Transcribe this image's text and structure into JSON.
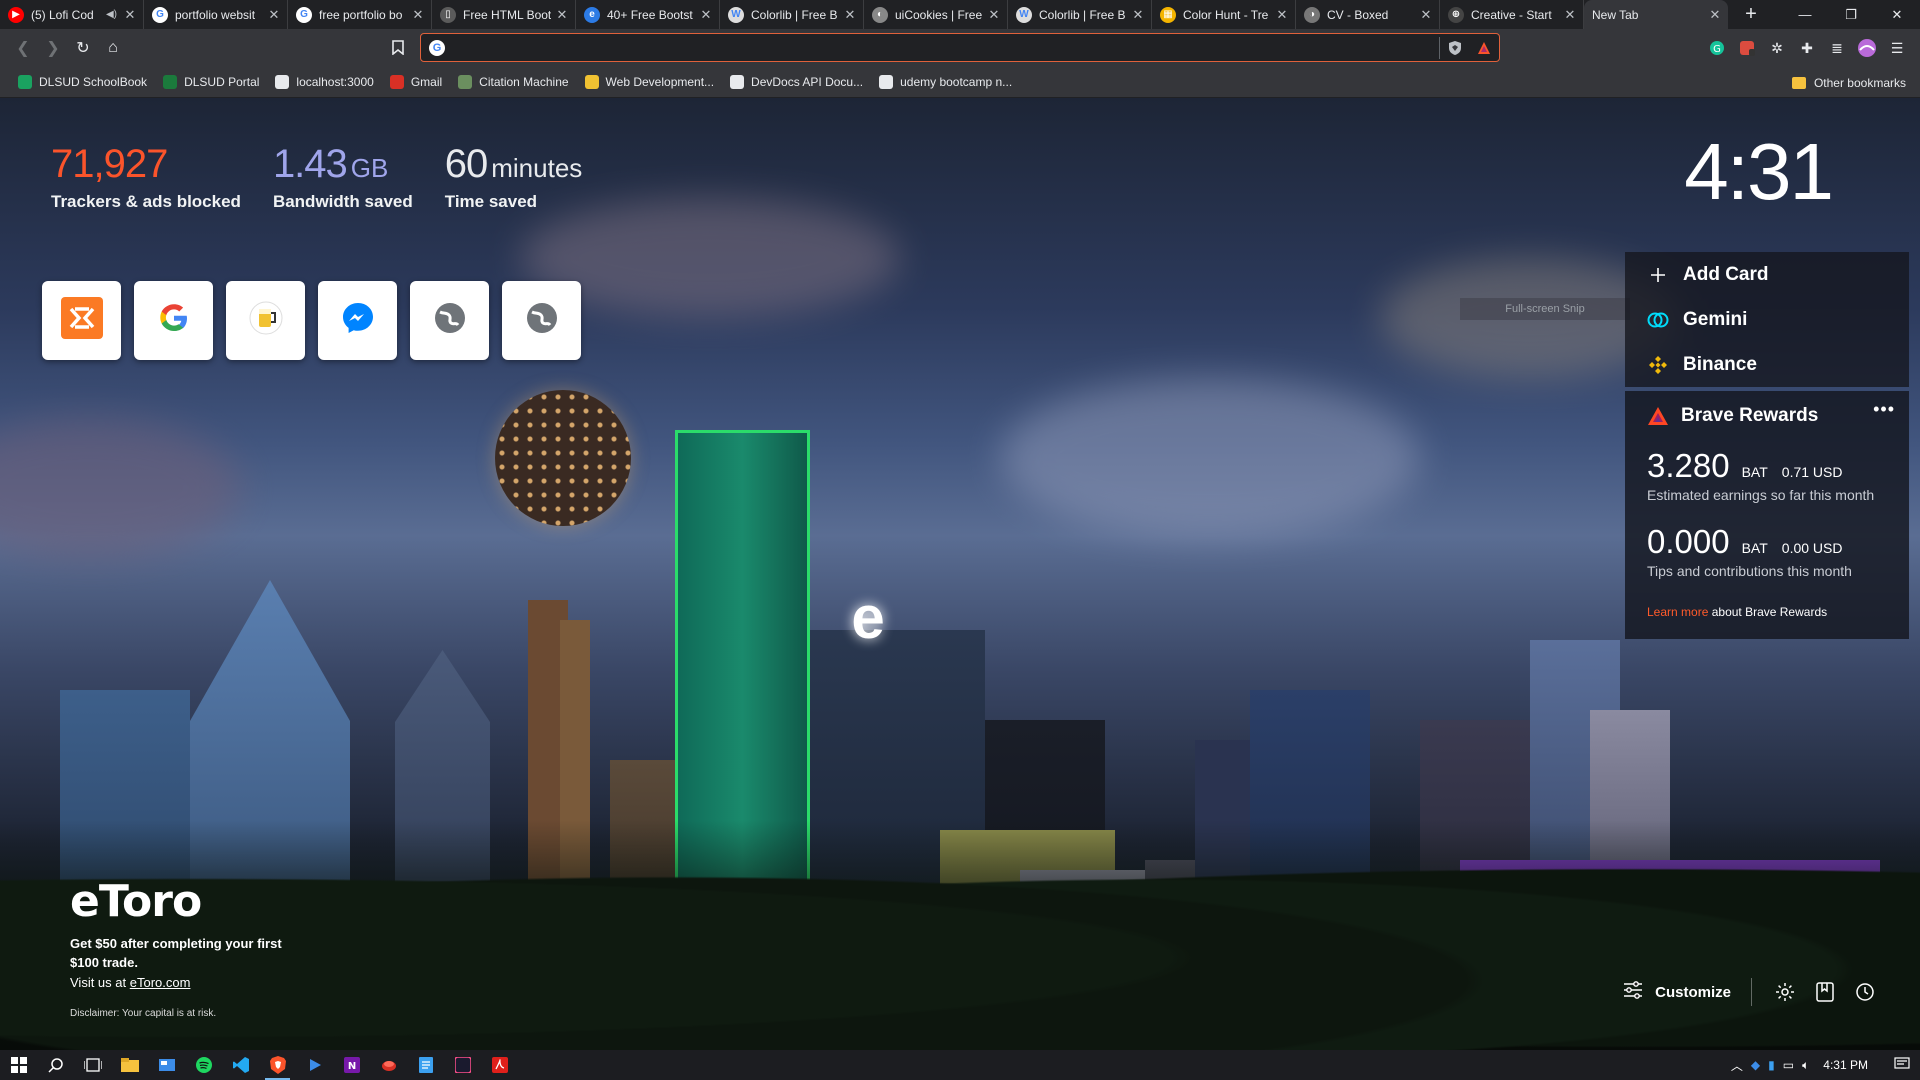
{
  "tabs": [
    {
      "title": "(5) Lofi Cod",
      "favicon_color": "#ff0000",
      "favicon_glyph": "▶",
      "audio": true
    },
    {
      "title": "portfolio websit",
      "favicon_color": "#ffffff",
      "favicon_glyph": "G"
    },
    {
      "title": "free portfolio bo",
      "favicon_color": "#ffffff",
      "favicon_glyph": "G"
    },
    {
      "title": "Free HTML Boot",
      "favicon_color": "#5b5b5b",
      "favicon_glyph": "▯"
    },
    {
      "title": "40+ Free Bootst",
      "favicon_color": "#2c7be5",
      "favicon_glyph": "e"
    },
    {
      "title": "Colorlib | Free B",
      "favicon_color": "#dddddd",
      "favicon_glyph": "W"
    },
    {
      "title": "uiCookies | Free",
      "favicon_color": "#888888",
      "favicon_glyph": "◐"
    },
    {
      "title": "Colorlib | Free B",
      "favicon_color": "#dddddd",
      "favicon_glyph": "W"
    },
    {
      "title": "Color Hunt - Tre",
      "favicon_color": "#f4b400",
      "favicon_glyph": "▦"
    },
    {
      "title": "CV - Boxed",
      "favicon_color": "#777777",
      "favicon_glyph": "◑"
    },
    {
      "title": "Creative - Start",
      "favicon_color": "#444444",
      "favicon_glyph": "⊕"
    },
    {
      "title": "New Tab",
      "favicon_color": "",
      "favicon_glyph": "",
      "active": true
    }
  ],
  "toolbar": {
    "url_value": "",
    "accent": "#e0613b"
  },
  "bookmarks": [
    {
      "label": "DLSUD SchoolBook",
      "color": "#1aa260"
    },
    {
      "label": "DLSUD Portal",
      "color": "#1b7a3c"
    },
    {
      "label": "localhost:3000",
      "color": "#e8eaed"
    },
    {
      "label": "Gmail",
      "color": "#d93025"
    },
    {
      "label": "Citation Machine",
      "color": "#6b8f5f"
    },
    {
      "label": "Web Development...",
      "color": "#f1c232"
    },
    {
      "label": "DevDocs API Docu...",
      "color": "#e8eaed"
    },
    {
      "label": "udemy bootcamp n...",
      "color": "#e8eaed"
    }
  ],
  "other_bookmarks": "Other bookmarks",
  "stats": {
    "trackers": {
      "value": "71,927",
      "label": "Trackers & ads blocked",
      "color": "#fb542b"
    },
    "bandwidth": {
      "value": "1.43",
      "unit": "GB",
      "label": "Bandwidth saved",
      "color": "#a0a5eb"
    },
    "time": {
      "value": "60",
      "unit": "minutes",
      "label": "Time saved",
      "color": "#ffffff"
    }
  },
  "clock": "4:31",
  "top_sites": [
    {
      "name": "xampp-icon",
      "color": "#fb7a24"
    },
    {
      "name": "google-icon",
      "color": "#4285f4"
    },
    {
      "name": "beer-app-icon",
      "color": "#f1c232"
    },
    {
      "name": "messenger-icon",
      "color": "#0084ff"
    },
    {
      "name": "globe-icon",
      "color": "#6f7479"
    },
    {
      "name": "globe-icon",
      "color": "#6f7479"
    }
  ],
  "cards": {
    "add_card": "Add Card",
    "gemini": "Gemini",
    "binance": "Binance"
  },
  "snip_tooltip": "Full-screen Snip",
  "rewards": {
    "title": "Brave Rewards",
    "earnings_bat": "3.280",
    "earnings_unit": "BAT",
    "earnings_usd": "0.71 USD",
    "earnings_desc": "Estimated earnings so far this month",
    "tips_bat": "0.000",
    "tips_unit": "BAT",
    "tips_usd": "0.00 USD",
    "tips_desc": "Tips and contributions this month",
    "learn_more": "Learn more",
    "learn_more_suffix": "about Brave Rewards"
  },
  "sponsor": {
    "logo": "eToro",
    "promo": "Get $50 after completing your first $100 trade.",
    "visit_prefix": "Visit us at",
    "visit_link": "eToro.com",
    "disclaimer": "Disclaimer: Your capital is at risk."
  },
  "ntp_actions": {
    "customize": "Customize"
  },
  "taskbar": {
    "time": "4:31 PM"
  }
}
